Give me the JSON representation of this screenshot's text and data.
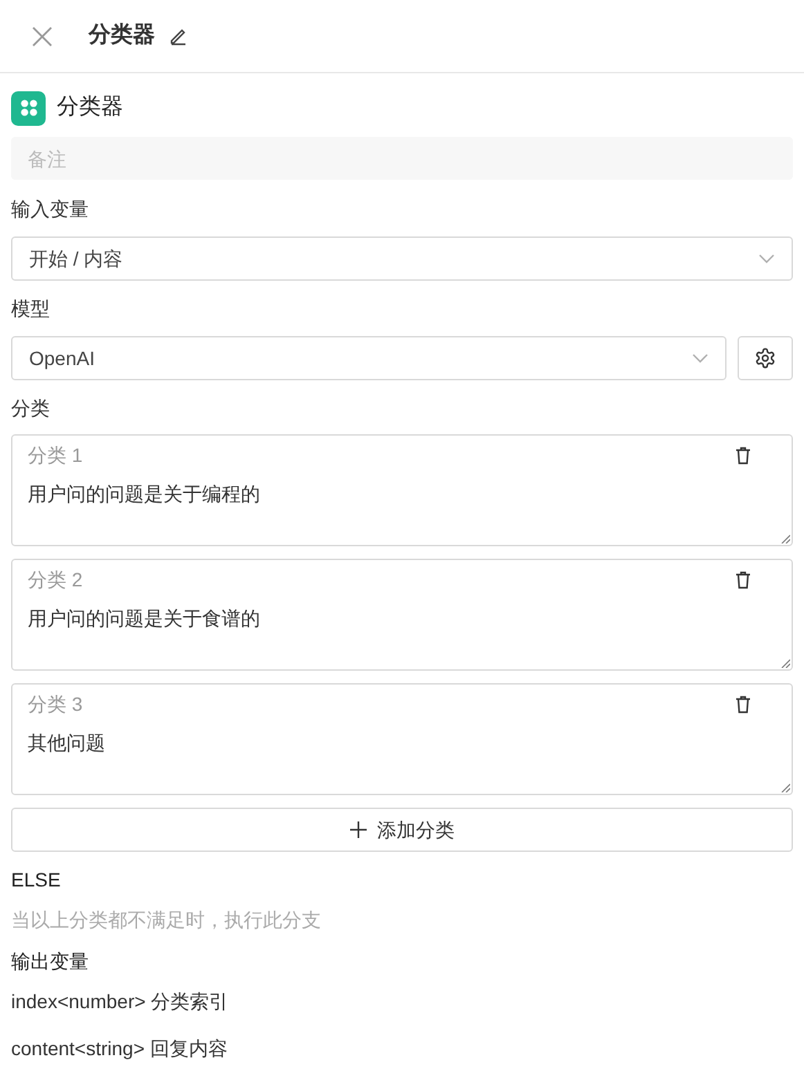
{
  "header": {
    "title": "分类器"
  },
  "node": {
    "title": "分类器",
    "note_placeholder": "备注"
  },
  "input": {
    "label": "输入变量",
    "value": "开始 / 内容"
  },
  "model": {
    "label": "模型",
    "value": "OpenAI"
  },
  "categories": {
    "label": "分类",
    "items": [
      {
        "name": "分类 1",
        "text": "用户问的问题是关于编程的"
      },
      {
        "name": "分类 2",
        "text": "用户问的问题是关于食谱的"
      },
      {
        "name": "分类 3",
        "text": "其他问题"
      }
    ],
    "add_button": "添加分类"
  },
  "else": {
    "label": "ELSE",
    "description": "当以上分类都不满足时，执行此分支"
  },
  "output": {
    "label": "输出变量",
    "items": [
      "index<number> 分类索引",
      "content<string> 回复内容"
    ]
  }
}
